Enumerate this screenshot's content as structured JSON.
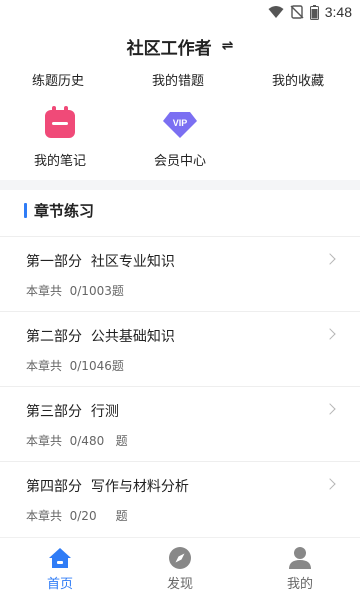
{
  "status_bar": {
    "time": "3:48",
    "icons": [
      "wifi-icon",
      "no-sim-icon",
      "battery-icon"
    ]
  },
  "header": {
    "title": "社区工作者",
    "switch_icon": "⇌"
  },
  "quick_links": [
    "练题历史",
    "我的错题",
    "我的收藏"
  ],
  "feature_icons": [
    {
      "label": "我的笔记",
      "icon": "calendar-icon"
    },
    {
      "label": "会员中心",
      "icon": "vip-icon",
      "icon_text": "VIP"
    }
  ],
  "section": {
    "title": "章节练习"
  },
  "chapters": [
    {
      "title": "第一部分  社区专业知识",
      "count": "本章共  0/1003题"
    },
    {
      "title": "第二部分  公共基础知识",
      "count": "本章共  0/1046题"
    },
    {
      "title": "第三部分  行测",
      "count": "本章共  0/480   题"
    },
    {
      "title": "第四部分  写作与材料分析",
      "count": "本章共  0/20     题"
    }
  ],
  "bottom_nav": [
    {
      "label": "首页",
      "icon": "home-icon",
      "active": true
    },
    {
      "label": "发现",
      "icon": "compass-icon",
      "active": false
    },
    {
      "label": "我的",
      "icon": "user-icon",
      "active": false
    }
  ],
  "colors": {
    "accent": "#2f7cf6",
    "note_icon": "#f04a78",
    "vip_icon": "#7b6ff2",
    "divider": "#f4f5f7"
  }
}
